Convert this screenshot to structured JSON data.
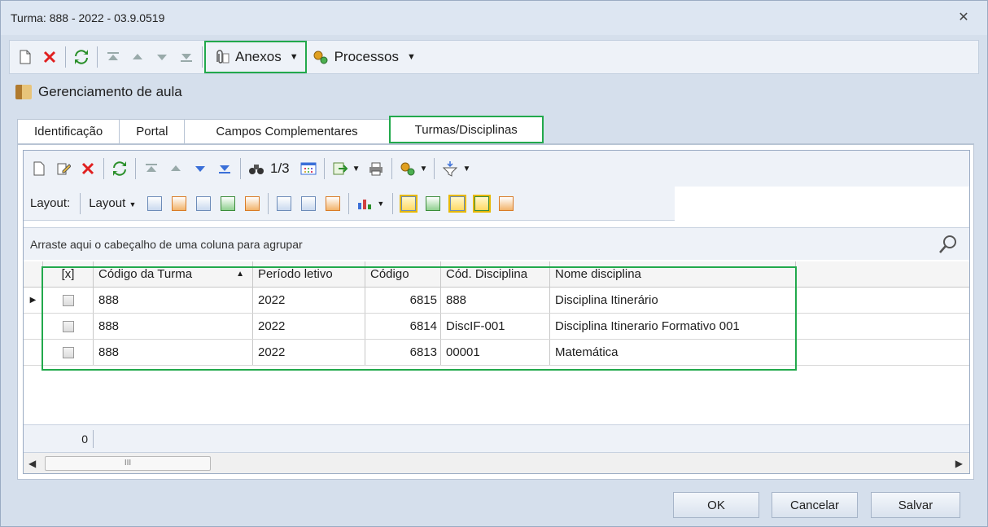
{
  "window": {
    "title": "Turma: 888 - 2022 - 03.9.0519",
    "close_glyph": "✕"
  },
  "toolbar": {
    "anexos_label": "Anexos",
    "processos_label": "Processos"
  },
  "section": {
    "title": "Gerenciamento de aula"
  },
  "tabs": [
    {
      "label": "Identificação"
    },
    {
      "label": "Portal"
    },
    {
      "label": "Campos Complementares"
    },
    {
      "label": "Turmas/Disciplinas"
    }
  ],
  "grid_toolbar": {
    "pager": "1/3"
  },
  "layout_bar": {
    "layout_label": "Layout:",
    "layout_dropdown": "Layout"
  },
  "group_hint": "Arraste aqui o cabeçalho de uma coluna para agrupar",
  "table": {
    "headers": [
      "[x]",
      "Código da Turma",
      "Período letivo",
      "Código",
      "Cód. Disciplina",
      "Nome disciplina"
    ],
    "rows": [
      {
        "turma": "888",
        "periodo": "2022",
        "codigo": "6815",
        "cod_disc": "888",
        "nome": "Disciplina Itinerário"
      },
      {
        "turma": "888",
        "periodo": "2022",
        "codigo": "6814",
        "cod_disc": "DiscIF-001",
        "nome": "Disciplina Itinerario Formativo 001"
      },
      {
        "turma": "888",
        "periodo": "2022",
        "codigo": "6813",
        "cod_disc": "00001",
        "nome": "Matemática"
      }
    ],
    "footer_count": "0",
    "scroll_mark": "III"
  },
  "buttons": {
    "ok": "OK",
    "cancel": "Cancelar",
    "save": "Salvar"
  },
  "colors": {
    "highlight": "#22a94c",
    "accent_red": "#e02020",
    "accent_green": "#2a8f2a",
    "accent_blue": "#3a6fd8"
  }
}
